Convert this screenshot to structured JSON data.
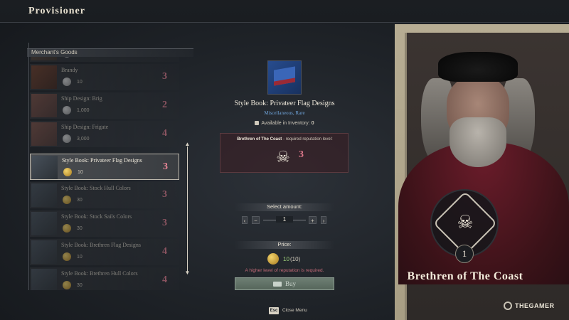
{
  "header": {
    "title": "Provisioner"
  },
  "list": {
    "caption": "Merchant's Goods",
    "partial_price": "10",
    "items": [
      {
        "name": "Brandy",
        "price": "10",
        "currency": "silver",
        "rep_level": "3",
        "thumb": "brandy"
      },
      {
        "name": "Ship Design: Brig",
        "price": "1,000",
        "currency": "silver",
        "rep_level": "2",
        "thumb": "ship"
      },
      {
        "name": "Ship Design: Frigate",
        "price": "3,000",
        "currency": "silver",
        "rep_level": "4",
        "thumb": "ship"
      },
      {
        "name": "Style Book: Privateer Flag Designs",
        "price": "10",
        "currency": "gold",
        "rep_level": "3",
        "thumb": "book",
        "selected": true
      },
      {
        "name": "Style Book: Stock Hull Colors",
        "price": "30",
        "currency": "gold",
        "rep_level": "3",
        "thumb": "book"
      },
      {
        "name": "Style Book: Stock Sails Colors",
        "price": "30",
        "currency": "gold",
        "rep_level": "3",
        "thumb": "book"
      },
      {
        "name": "Style Book: Brethren Flag Designs",
        "price": "10",
        "currency": "gold",
        "rep_level": "4",
        "thumb": "book"
      },
      {
        "name": "Style Book: Brethren Hull Colors",
        "price": "30",
        "currency": "gold",
        "rep_level": "4",
        "thumb": "book"
      }
    ]
  },
  "detail": {
    "title": "Style Book: Privateer Flag Designs",
    "subtitle": "Miscellaneous, Rare",
    "inventory_label": "Available in Inventory:",
    "inventory_count": "0",
    "rep_faction": "Brethren of The Coast",
    "rep_suffix": " - required reputation level:",
    "rep_required": "3",
    "amount_label": "Select amount:",
    "amount_value": "1",
    "minus_label": "−",
    "plus_label": "+",
    "left_key": "‹",
    "right_key": "›",
    "price_label": "Price:",
    "price_value": "10",
    "price_paren": "(10)",
    "warning": "A higher level of reputation is required.",
    "buy_label": "Buy"
  },
  "footer": {
    "esc_key": "Esc",
    "close_label": "Close Menu"
  },
  "portrait": {
    "faction_name": "Brethren of The Coast",
    "player_level": "1"
  },
  "watermark": {
    "text": "THEGAMER"
  },
  "colors": {
    "rep_badge": "#e07a8c",
    "subtitle": "#6ea2d8",
    "price_ok": "#9fd17a",
    "warning": "#c46a78"
  }
}
